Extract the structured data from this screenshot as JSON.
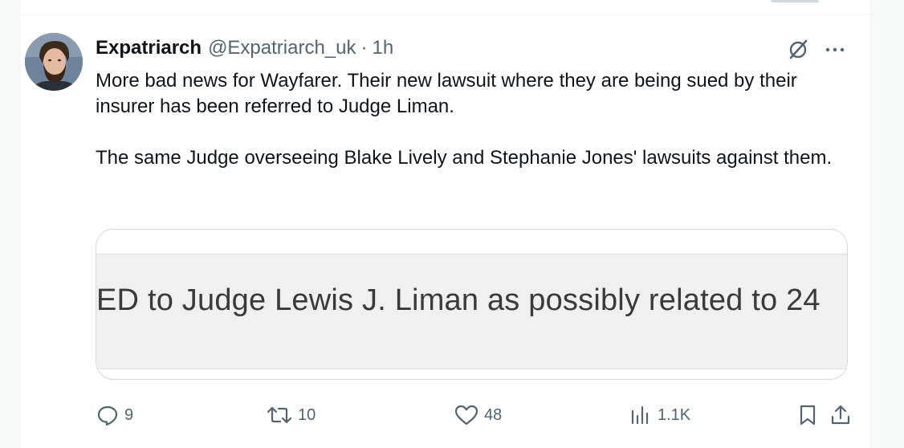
{
  "tweet": {
    "display_name": "Expatriarch",
    "handle": "@Expatriarch_uk",
    "separator": "·",
    "time": "1h",
    "text_paragraphs": [
      "More bad news for Wayfarer. Their new lawsuit where they are being sued by their insurer has been referred to Judge Liman.",
      "The same Judge overseeing Blake Lively and Stephanie Jones' lawsuits against them."
    ],
    "media_caption": "ED to Judge Lewis J. Liman as possibly related to 24",
    "icons": {
      "avatar": "avatar-bearded-man",
      "grok": "grok-icon",
      "more": "more-dots-icon"
    }
  },
  "actions": {
    "reply": {
      "icon": "reply-icon",
      "count": "9"
    },
    "retweet": {
      "icon": "retweet-icon",
      "count": "10"
    },
    "like": {
      "icon": "heart-icon",
      "count": "48"
    },
    "views": {
      "icon": "views-bar-chart-icon",
      "count": "1.1K"
    },
    "bookmark": {
      "icon": "bookmark-icon"
    },
    "share": {
      "icon": "share-icon"
    }
  },
  "colors": {
    "text_primary": "#0f1419",
    "text_secondary": "#536471",
    "border": "#cfd9de",
    "frame": "#f7f9f9"
  }
}
